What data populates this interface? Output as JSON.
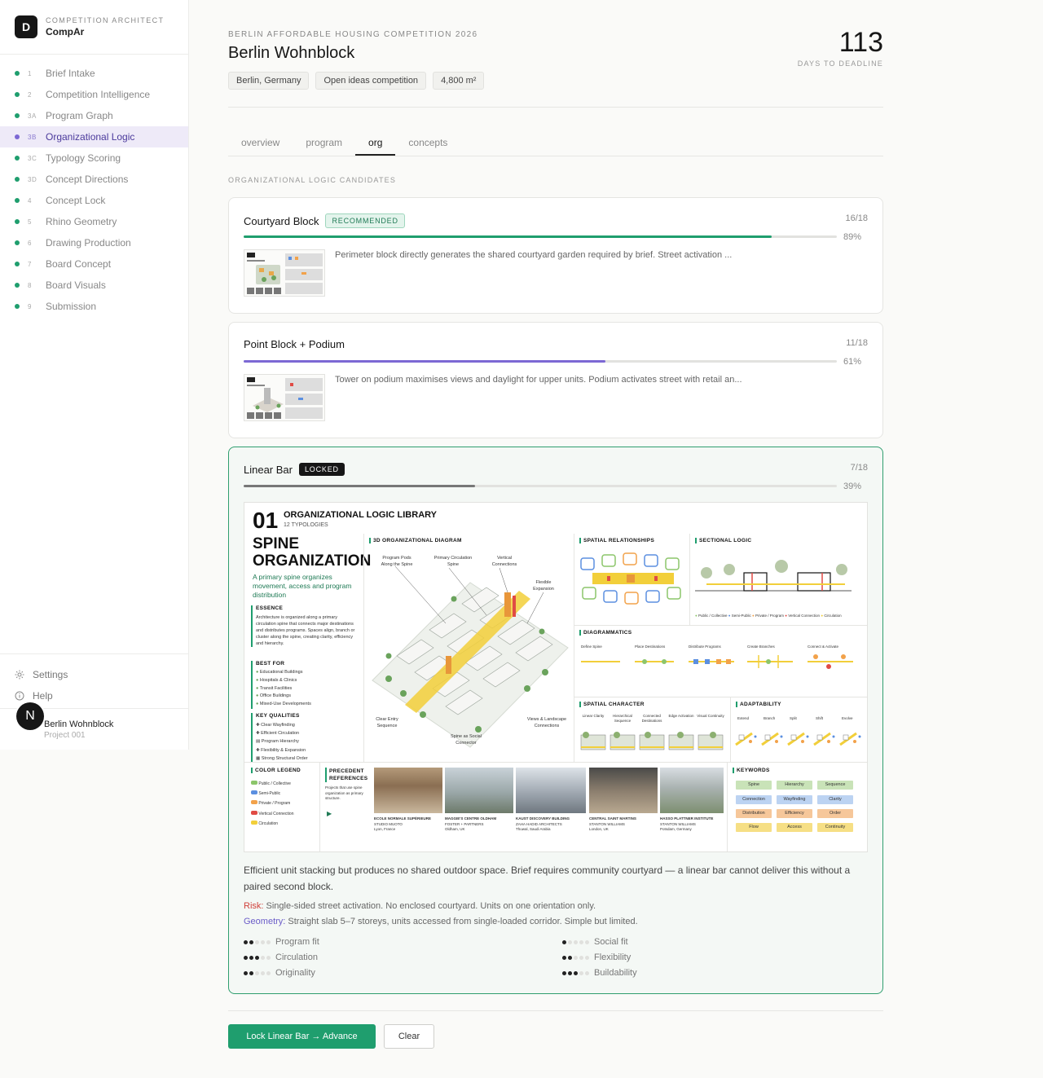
{
  "brand": {
    "logo_letter": "D",
    "subtitle": "COMPETITION ARCHITECT",
    "name": "CompAr"
  },
  "steps": [
    {
      "num": "1",
      "label": "Brief Intake"
    },
    {
      "num": "2",
      "label": "Competition Intelligence"
    },
    {
      "num": "3A",
      "label": "Program Graph"
    },
    {
      "num": "3B",
      "label": "Organizational Logic",
      "active": true
    },
    {
      "num": "3C",
      "label": "Typology Scoring"
    },
    {
      "num": "3D",
      "label": "Concept Directions"
    },
    {
      "num": "4",
      "label": "Concept Lock"
    },
    {
      "num": "5",
      "label": "Rhino Geometry"
    },
    {
      "num": "6",
      "label": "Drawing Production"
    },
    {
      "num": "7",
      "label": "Board Concept"
    },
    {
      "num": "8",
      "label": "Board Visuals"
    },
    {
      "num": "9",
      "label": "Submission"
    }
  ],
  "sidebar_bottom": {
    "settings_label": "Settings",
    "help_label": "Help"
  },
  "project": {
    "avatar_letter": "N",
    "name": "Berlin Wohnblock",
    "id": "Project 001"
  },
  "header": {
    "eyebrow": "BERLIN AFFORDABLE HOUSING COMPETITION 2026",
    "title": "Berlin Wohnblock",
    "chips": [
      "Berlin, Germany",
      "Open ideas competition",
      "4,800 m²"
    ],
    "days": "113",
    "days_label": "DAYS TO DEADLINE"
  },
  "tabs": [
    {
      "label": "overview"
    },
    {
      "label": "program"
    },
    {
      "label": "org",
      "active": true
    },
    {
      "label": "concepts"
    }
  ],
  "section_label": "ORGANIZATIONAL LOGIC CANDIDATES",
  "candidates": [
    {
      "title": "Courtyard Block",
      "badge": "RECOMMENDED",
      "score": "16/18",
      "percent": "89%",
      "progress": 0.89,
      "bar_color": "#1f9e6e",
      "description": "Perimeter block directly generates the shared courtyard garden required by brief. Street activation ..."
    },
    {
      "title": "Point Block + Podium",
      "badge": "",
      "score": "11/18",
      "percent": "61%",
      "progress": 0.61,
      "bar_color": "#7c68d4",
      "description": "Tower on podium maximises views and daylight for upper units. Podium activates street with retail an..."
    },
    {
      "title": "Linear Bar",
      "badge": "LOCKED",
      "score": "7/18",
      "percent": "39%",
      "progress": 0.39,
      "bar_color": "#777777",
      "description": "Efficient unit stacking but produces no shared outdoor space. Brief requires community courtyard — a linear bar cannot deliver this without a paired second block.",
      "risk_label": "Risk:",
      "risk_text": " Single-sided street activation. No enclosed courtyard. Units on one orientation only.",
      "geometry_label": "Geometry:",
      "geometry_text": " Straight slab 5–7 storeys, units accessed from single-loaded corridor. Simple but limited.",
      "metrics": [
        {
          "label": "Program fit",
          "value": 2
        },
        {
          "label": "Social fit",
          "value": 1
        },
        {
          "label": "Circulation",
          "value": 3
        },
        {
          "label": "Flexibility",
          "value": 2
        },
        {
          "label": "Originality",
          "value": 2
        },
        {
          "label": "Buildability",
          "value": 3
        }
      ]
    }
  ],
  "board": {
    "number": "01",
    "library_title": "ORGANIZATIONAL LOGIC LIBRARY",
    "typologies": "12 TYPOLOGIES",
    "name_line1": "SPINE",
    "name_line2": "ORGANIZATION",
    "tagline": "A primary spine organizes movement, access and program distribution",
    "essence_h": "ESSENCE",
    "essence_t": "Architecture is organized along a primary circulation spine that connects major destinations and distributes programs. Spaces align, branch or cluster along the spine, creating clarity, efficiency and hierarchy.",
    "best_for_h": "BEST FOR",
    "best_for": [
      "Educational Buildings",
      "Hospitals & Clinics",
      "Transit Facilities",
      "Office Buildings",
      "Mixed-Use Developments"
    ],
    "key_q_h": "KEY QUALITIES",
    "key_q": [
      "Clear Wayfinding",
      "Efficient Circulation",
      "Program Hierarchy",
      "Flexibility & Expansion",
      "Strong Structural Order"
    ],
    "diagram_h": "3D ORGANIZATIONAL DIAGRAM",
    "diagram_labels": [
      "Program Pods Along the Spine",
      "Primary Circulation Spine",
      "Vertical Connections",
      "Flexible Expansion",
      "Clear Entry Sequence",
      "Spine as Social Connector",
      "Views & Landscape Connections"
    ],
    "spatial_rel_h": "SPATIAL RELATIONSHIPS",
    "sectional_h": "SECTIONAL LOGIC",
    "sectional_legend": [
      "Public / Collective",
      "Semi-Public",
      "Private / Program",
      "Vertical Connection",
      "Circulation"
    ],
    "diagrammatics_h": "DIAGRAMMATICS",
    "diagrammatics": [
      "Define Spine",
      "Place Destinations",
      "Distribute Programs",
      "Create Branches",
      "Connect & Activate"
    ],
    "spatial_char_h": "SPATIAL CHARACTER",
    "spatial_char": [
      "Linear Clarity",
      "Hierarchical Sequence",
      "Connected Destinations",
      "Edge Activation",
      "Visual Continuity"
    ],
    "adaptability_h": "ADAPTABILITY",
    "adaptability": [
      "Extend",
      "Branch",
      "Split",
      "Shift",
      "Evolve"
    ],
    "legend_h": "COLOR LEGEND",
    "legend": [
      "Public / Collective",
      "Semi-Public",
      "Private / Program",
      "Vertical Connection",
      "Circulation"
    ],
    "precedent_h": "PRECEDENT REFERENCES",
    "precedent_t": "Projects that use spine organization as primary structure.",
    "precedents": [
      {
        "name": "ECOLE NORMALE SUPÉRIEURE",
        "firm": "STUDIO MUOTO",
        "place": "Lyon, France"
      },
      {
        "name": "MAGGIE'S CENTRE OLDHAM",
        "firm": "FOSTER + PARTNERS",
        "place": "Oldham, UK"
      },
      {
        "name": "KAUST DISCOVERY BUILDING",
        "firm": "ZAHA HADID ARCHITECTS",
        "place": "Thuwal, Saudi Arabia"
      },
      {
        "name": "CENTRAL SAINT MARTINS",
        "firm": "STANTON WILLIAMS",
        "place": "London, UK"
      },
      {
        "name": "HASSO PLATTNER INSTITUTE",
        "firm": "STANTON WILLIAMS",
        "place": "Potsdam, Germany"
      }
    ],
    "keywords_h": "KEYWORDS",
    "keywords": [
      "Spine",
      "Hierarchy",
      "Sequence",
      "Connection",
      "Wayfinding",
      "Clarity",
      "Distribution",
      "Efficiency",
      "Order",
      "Flow",
      "Access",
      "Continuity"
    ],
    "colors": {
      "public": "#8cc56a",
      "semi": "#5b8fe0",
      "private": "#f2a24a",
      "vertical": "#e04b45",
      "circulation": "#f2cf3a"
    }
  },
  "actions": {
    "primary": "Lock Linear Bar → Advance",
    "secondary": "Clear"
  }
}
